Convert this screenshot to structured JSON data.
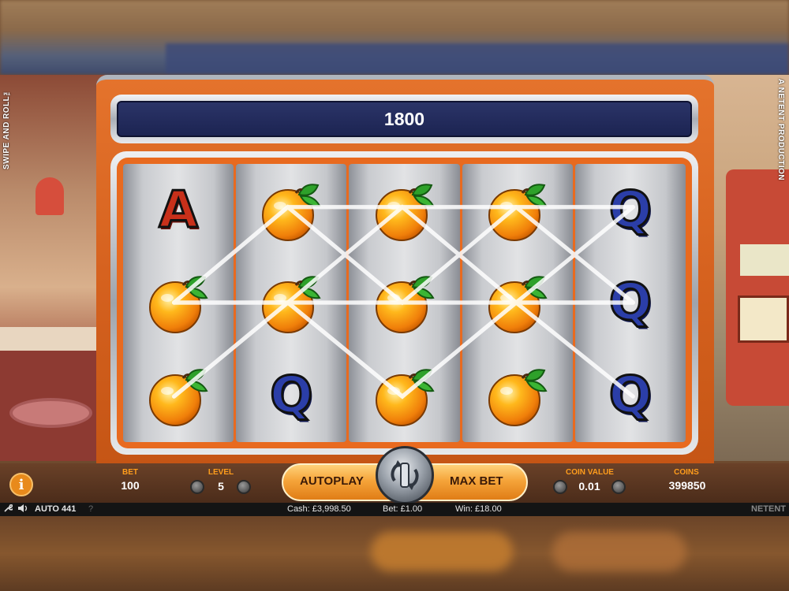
{
  "side_text": {
    "left": "SWIPE AND ROLL™",
    "right": "A NETENT PRODUCTION"
  },
  "win_display": {
    "value": "1800"
  },
  "reels": [
    [
      "letter-A",
      "orange",
      "orange"
    ],
    [
      "orange",
      "orange",
      "letter-Q"
    ],
    [
      "orange",
      "orange",
      "orange"
    ],
    [
      "orange",
      "orange",
      "orange"
    ],
    [
      "letter-Q",
      "letter-Q",
      "letter-Q"
    ]
  ],
  "controls": {
    "bet_label": "BET",
    "bet_value": "100",
    "level_label": "LEVEL",
    "level_value": "5",
    "autoplay_label": "AUTOPLAY",
    "maxbet_label": "MAX BET",
    "coin_value_label": "COIN VALUE",
    "coin_value": "0.01",
    "coins_label": "COINS",
    "coins_value": "399850",
    "info_label": "i"
  },
  "status": {
    "auto_label": "AUTO 441",
    "help": "?",
    "cash": "Cash: £3,998.50",
    "bet": "Bet: £1.00",
    "win": "Win: £18.00",
    "brand": "NETENT"
  },
  "colors": {
    "cabinet_orange": "#e4732c",
    "display_navy": "#2b3468",
    "control_label_orange": "#ff9d1c",
    "letter_A": "#c8301a",
    "letter_Q": "#2b3ea8"
  }
}
